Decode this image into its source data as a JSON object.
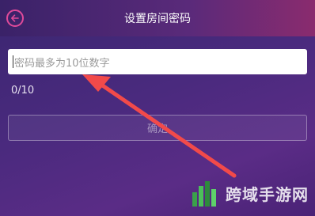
{
  "header": {
    "title": "设置房间密码",
    "back_icon": "back-arrow-icon",
    "back_icon_color": "#e04a9a"
  },
  "form": {
    "password_placeholder": "密码最多为10位数字",
    "password_value": "",
    "char_counter": "0/10",
    "confirm_label": "确定"
  },
  "watermark": {
    "text": "跨域手游网"
  },
  "colors": {
    "annotation_arrow": "#f24a4a",
    "background": "#4a2a7e"
  }
}
